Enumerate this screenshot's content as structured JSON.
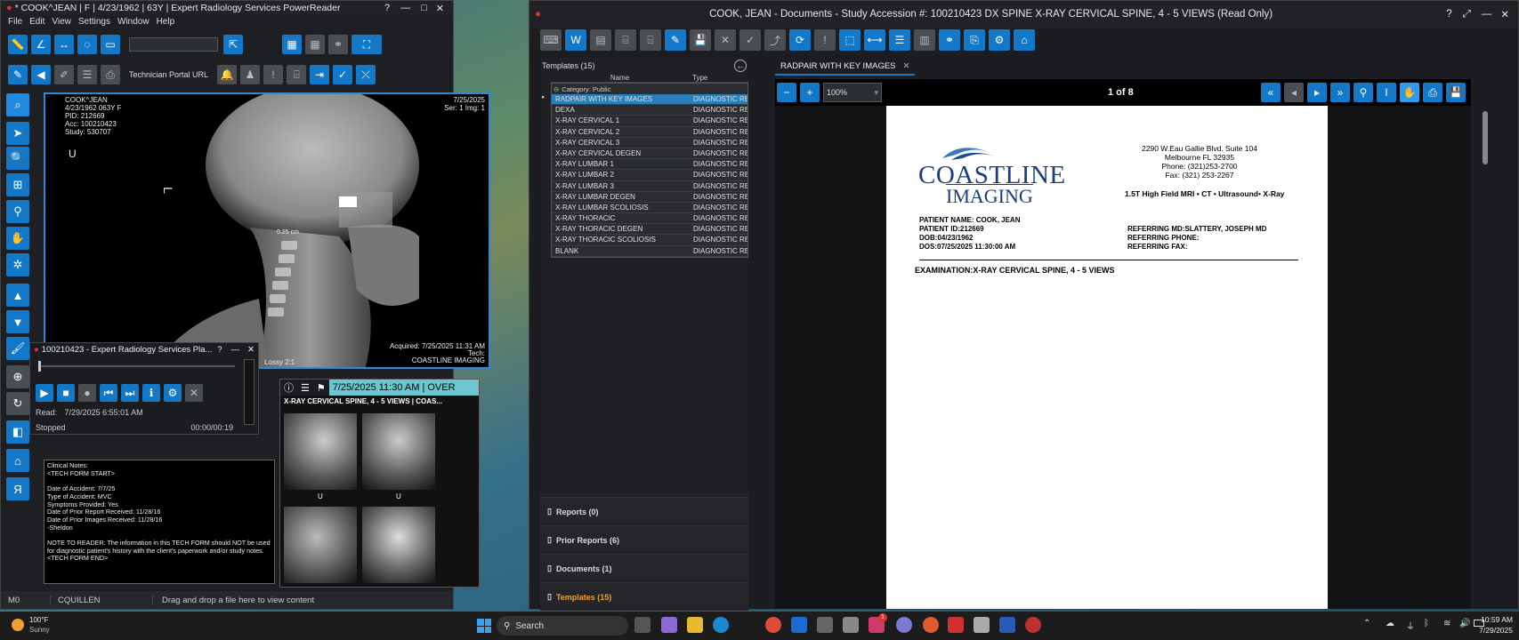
{
  "left_window": {
    "title": "* COOK^JEAN | F | 4/23/1962 | 63Y | Expert Radiology Services PowerReader",
    "menu": [
      "File",
      "Edit",
      "View",
      "Settings",
      "Window",
      "Help"
    ],
    "technician_portal": "Technician Portal URL",
    "image_info": {
      "name": "COOK^JEAN",
      "dob": "4/23/1962 063Y F",
      "pid": "PID: 212669",
      "acc": "Acc: 100210423",
      "study": "Study: 530707",
      "date": "7/25/2025",
      "series": "Ser: 1 Img: 1",
      "marker": "U",
      "measure": "0.25 cm",
      "acquired": "Acquired: 7/25/2025 11:31 AM",
      "tech": "Tech:",
      "facility": "COASTLINE IMAGING",
      "compression": "Lossy 2:1",
      "orientation": "L"
    },
    "dictation": {
      "title": "100210423 - Expert Radiology Services Pla...",
      "read": "Read:",
      "read_time": "7/29/2025 6:55:01 AM",
      "status": "Stopped",
      "time": "00:00/00:19"
    },
    "series_panel": {
      "header": "7/25/2025 11:30 AM | OVER",
      "subheader": "X-RAY CERVICAL SPINE, 4 - 5 VIEWS | COAS...",
      "thumb_labels": [
        "U",
        "U"
      ]
    },
    "clinical_notes": [
      "Clinical Notes:",
      "<TECH FORM START>",
      "",
      "Date of Accident: 7/7/25",
      "Type of Accident: MVC",
      "Symptoms Provided: Yes",
      "Date of Prior Report Received: 11/28/16",
      "Date of Prior Images Received: 11/28/16",
      "-Sheldon",
      "",
      "NOTE TO READER: The information in this TECH FORM should NOT be used for diagnostic patient's history with the client's paperwork and/or study notes.",
      "<TECH FORM END>"
    ],
    "status_bar": {
      "mode": "M0",
      "user": "CQUILLEN",
      "hint": "Drag and drop a file here to view content"
    }
  },
  "right_window": {
    "title": "COOK, JEAN - Documents - Study Accession #: 100210423 DX SPINE X-RAY CERVICAL SPINE, 4 - 5 VIEWS (Read Only)",
    "templates_header": "Templates (15)",
    "col_name": "Name",
    "col_type": "Type",
    "category_label": "Category: Public",
    "templates": [
      {
        "name": "RADPAIR WITH KEY IMAGES",
        "type": "DIAGNOSTIC REP..."
      },
      {
        "name": "DEXA",
        "type": "DIAGNOSTIC REP..."
      },
      {
        "name": "X-RAY CERVICAL 1",
        "type": "DIAGNOSTIC REP..."
      },
      {
        "name": "X-RAY CERVICAL 2",
        "type": "DIAGNOSTIC REP..."
      },
      {
        "name": "X-RAY CERVICAL 3",
        "type": "DIAGNOSTIC REP..."
      },
      {
        "name": "X-RAY CERVICAL DEGEN",
        "type": "DIAGNOSTIC REP..."
      },
      {
        "name": "X-RAY LUMBAR 1",
        "type": "DIAGNOSTIC REP..."
      },
      {
        "name": "X-RAY LUMBAR 2",
        "type": "DIAGNOSTIC REP..."
      },
      {
        "name": "X-RAY LUMBAR 3",
        "type": "DIAGNOSTIC REP..."
      },
      {
        "name": "X-RAY LUMBAR DEGEN",
        "type": "DIAGNOSTIC REP..."
      },
      {
        "name": "X-RAY LUMBAR SCOLIOSIS",
        "type": "DIAGNOSTIC REP..."
      },
      {
        "name": "X-RAY THORACIC",
        "type": "DIAGNOSTIC REP..."
      },
      {
        "name": "X-RAY THORACIC DEGEN",
        "type": "DIAGNOSTIC REP..."
      },
      {
        "name": "X-RAY THORACIC SCOLIOSIS",
        "type": "DIAGNOSTIC REP..."
      },
      {
        "name": "BLANK",
        "type": "DIAGNOSTIC REP..."
      }
    ],
    "accordion": [
      "Reports (0)",
      "Prior Reports (6)",
      "Documents (1)",
      "Templates (15)"
    ],
    "doc_tab": "RADPAIR WITH KEY IMAGES",
    "zoom": "100%",
    "page": "1 of 8",
    "document": {
      "logo_line1": "COASTLINE",
      "logo_line2": "IMAGING",
      "address1": "2290 W.Eau Gallie Blvd. Suite 104",
      "address2": "Melbourne FL 32935",
      "phone": "Phone: (321)253-2700",
      "fax": "Fax: (321) 253-2267",
      "services": "1.5T High Field MRI • CT • Ultrasound• X-Ray",
      "patient_name": "PATIENT NAME: COOK, JEAN",
      "patient_id": "PATIENT ID:212669",
      "dob": "DOB:04/23/1962",
      "dos": "DOS:07/25/2025 11:30:00 AM",
      "ref_md": "REFERRING MD:SLATTERY, JOSEPH MD",
      "ref_phone": "REFERRING PHONE:",
      "ref_fax": "REFERRING FAX:",
      "exam": "EXAMINATION:X-RAY CERVICAL SPINE, 4 - 5 VIEWS"
    }
  },
  "taskbar": {
    "weather_temp": "100°F",
    "weather_desc": "Sunny",
    "search": "Search",
    "time": "10:59 AM",
    "date": "7/29/2025",
    "badge": "1"
  },
  "colors": {
    "accent": "#1478c8",
    "selected_row": "#2a7fb8",
    "orange": "#f0a030"
  }
}
